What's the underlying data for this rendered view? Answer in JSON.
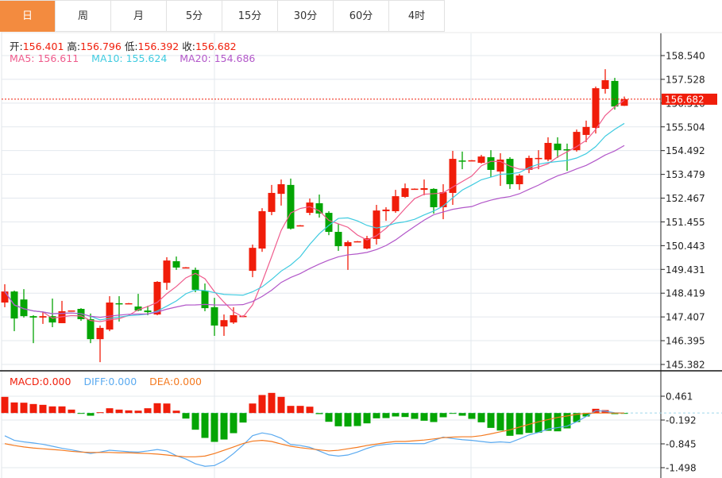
{
  "tabs": [
    {
      "label": "日",
      "active": true
    },
    {
      "label": "周"
    },
    {
      "label": "月"
    },
    {
      "label": "5分"
    },
    {
      "label": "15分"
    },
    {
      "label": "30分"
    },
    {
      "label": "60分"
    },
    {
      "label": "4时"
    }
  ],
  "ohlc_info": {
    "open_label": "开:",
    "open": "156.401",
    "high_label": "高:",
    "high": "156.796",
    "low_label": "低:",
    "low": "156.392",
    "close_label": "收:",
    "close": "156.682"
  },
  "ma_info": {
    "ma5": "MA5: 156.611",
    "ma10": "MA10: 155.624",
    "ma20": "MA20: 154.686"
  },
  "macd_info": {
    "macd": "MACD:0.000",
    "diff": "DIFF:0.000",
    "dea": "DEA:0.000"
  },
  "colors": {
    "up": "#f01d0a",
    "down": "#04a504",
    "ma5": "#ef5b8c",
    "ma10": "#3fcbe0",
    "ma20": "#b257c9",
    "diff": "#5aaaf0",
    "dea": "#f47a20",
    "active_tab": "#f38b3f"
  },
  "chart_data": [
    {
      "type": "candlestick",
      "price_ticks": [
        "158.540",
        "157.528",
        "156.516",
        "155.504",
        "154.492",
        "153.479",
        "152.467",
        "151.455",
        "150.443",
        "149.431",
        "148.419",
        "147.407",
        "146.395",
        "145.382"
      ],
      "ylim": [
        145.382,
        158.54
      ],
      "current_price": "156.682",
      "grid": true,
      "candles_ohlc": [
        [
          148.02,
          148.8,
          147.82,
          148.49
        ],
        [
          148.49,
          148.53,
          146.8,
          147.34
        ],
        [
          148.15,
          148.59,
          147.38,
          147.44
        ],
        [
          147.44,
          147.48,
          146.29,
          147.38
        ],
        [
          147.38,
          147.61,
          147.11,
          147.44
        ],
        [
          147.44,
          148.19,
          146.97,
          147.17
        ],
        [
          147.14,
          148.09,
          147.14,
          147.65
        ],
        [
          147.65,
          147.68,
          147.65,
          147.68
        ],
        [
          147.75,
          147.78,
          147.24,
          147.31
        ],
        [
          147.31,
          147.55,
          146.29,
          146.46
        ],
        [
          146.46,
          147.04,
          145.48,
          146.94
        ],
        [
          146.87,
          148.29,
          146.8,
          148.02
        ],
        [
          147.99,
          148.29,
          147.21,
          147.95
        ],
        [
          147.97,
          148.0,
          147.96,
          147.99
        ],
        [
          147.85,
          148.39,
          147.65,
          147.68
        ],
        [
          147.68,
          147.88,
          147.48,
          147.61
        ],
        [
          147.51,
          148.93,
          147.48,
          148.9
        ],
        [
          148.86,
          149.95,
          148.56,
          149.81
        ],
        [
          149.78,
          149.98,
          149.41,
          149.51
        ],
        [
          149.5,
          149.53,
          149.49,
          149.52
        ],
        [
          149.41,
          149.51,
          148.46,
          148.56
        ],
        [
          148.53,
          148.83,
          147.65,
          147.78
        ],
        [
          147.82,
          148.22,
          146.6,
          147.04
        ],
        [
          147.0,
          147.51,
          146.6,
          147.27
        ],
        [
          147.17,
          147.82,
          147.11,
          147.48
        ],
        [
          147.43,
          147.47,
          147.42,
          147.45
        ],
        [
          149.37,
          150.49,
          149.1,
          150.35
        ],
        [
          150.32,
          152.04,
          150.18,
          151.91
        ],
        [
          151.88,
          153.03,
          151.74,
          152.69
        ],
        [
          152.65,
          153.26,
          152.15,
          153.06
        ],
        [
          153.03,
          153.3,
          151.13,
          151.17
        ],
        [
          151.29,
          151.32,
          151.28,
          151.31
        ],
        [
          151.84,
          152.45,
          151.74,
          152.28
        ],
        [
          152.25,
          152.62,
          151.64,
          151.81
        ],
        [
          151.84,
          151.91,
          150.89,
          151.03
        ],
        [
          151.03,
          151.37,
          150.22,
          150.42
        ],
        [
          150.42,
          150.66,
          149.41,
          150.59
        ],
        [
          150.61,
          150.64,
          150.6,
          150.63
        ],
        [
          150.32,
          150.86,
          150.29,
          150.76
        ],
        [
          150.73,
          152.18,
          150.49,
          151.94
        ],
        [
          151.91,
          152.08,
          151.5,
          151.98
        ],
        [
          151.91,
          152.82,
          151.84,
          152.55
        ],
        [
          152.52,
          153.09,
          152.48,
          152.89
        ],
        [
          152.85,
          152.88,
          152.84,
          152.87
        ],
        [
          152.82,
          153.26,
          152.59,
          152.89
        ],
        [
          152.86,
          152.89,
          151.81,
          152.08
        ],
        [
          152.08,
          153.06,
          151.57,
          152.72
        ],
        [
          152.69,
          154.48,
          152.18,
          154.14
        ],
        [
          154.07,
          154.45,
          153.7,
          154.04
        ],
        [
          154.06,
          154.09,
          154.05,
          154.08
        ],
        [
          153.97,
          154.31,
          153.94,
          154.24
        ],
        [
          154.21,
          154.51,
          153.36,
          153.67
        ],
        [
          153.6,
          154.38,
          152.99,
          154.11
        ],
        [
          154.14,
          154.21,
          152.86,
          153.06
        ],
        [
          153.06,
          153.5,
          152.82,
          153.43
        ],
        [
          153.67,
          154.28,
          153.53,
          154.18
        ],
        [
          154.14,
          154.51,
          153.7,
          154.18
        ],
        [
          154.11,
          155.06,
          154.04,
          154.82
        ],
        [
          154.79,
          155.06,
          154.18,
          154.51
        ],
        [
          154.55,
          154.79,
          153.63,
          154.51
        ],
        [
          154.51,
          155.39,
          154.45,
          155.29
        ],
        [
          155.16,
          155.77,
          154.85,
          155.5
        ],
        [
          155.46,
          157.22,
          155.22,
          157.15
        ],
        [
          157.12,
          157.96,
          156.92,
          157.49
        ],
        [
          157.46,
          157.59,
          156.24,
          156.37
        ],
        [
          156.401,
          156.796,
          156.392,
          156.682
        ]
      ],
      "moving_averages": [
        5,
        10,
        20
      ]
    },
    {
      "type": "bar+line",
      "ticks": [
        "0.461",
        "-0.192",
        "-0.845",
        "-1.498"
      ],
      "ylim": [
        -1.498,
        0.461
      ],
      "histogram": [
        0.443,
        0.29,
        0.283,
        0.247,
        0.225,
        0.182,
        0.182,
        0.094,
        -0.01,
        -0.073,
        0.022,
        0.131,
        0.094,
        0.073,
        0.065,
        0.131,
        0.269,
        0.261,
        0.065,
        -0.152,
        -0.457,
        -0.682,
        -0.791,
        -0.726,
        -0.552,
        -0.261,
        0.261,
        0.494,
        0.552,
        0.443,
        0.196,
        0.196,
        0.174,
        -0.029,
        -0.24,
        -0.363,
        -0.37,
        -0.356,
        -0.283,
        -0.145,
        -0.138,
        -0.094,
        -0.109,
        -0.16,
        -0.211,
        -0.247,
        -0.116,
        -0.005,
        -0.073,
        -0.16,
        -0.254,
        -0.407,
        -0.479,
        -0.624,
        -0.588,
        -0.545,
        -0.537,
        -0.486,
        -0.501,
        -0.421,
        -0.247,
        -0.094,
        0.116,
        0.08,
        -0.029,
        -0.01
      ],
      "diff": [
        -0.624,
        -0.748,
        -0.79,
        -0.82,
        -0.857,
        -0.91,
        -0.966,
        -1.01,
        -1.06,
        -1.11,
        -1.07,
        -1.02,
        -1.04,
        -1.06,
        -1.07,
        -1.04,
        -1.0,
        -1.04,
        -1.17,
        -1.26,
        -1.39,
        -1.46,
        -1.44,
        -1.31,
        -1.11,
        -0.88,
        -0.62,
        -0.545,
        -0.59,
        -0.69,
        -0.864,
        -0.89,
        -0.94,
        -1.04,
        -1.147,
        -1.18,
        -1.15,
        -1.07,
        -0.97,
        -0.89,
        -0.86,
        -0.835,
        -0.835,
        -0.84,
        -0.84,
        -0.75,
        -0.66,
        -0.7,
        -0.73,
        -0.75,
        -0.78,
        -0.81,
        -0.79,
        -0.81,
        -0.71,
        -0.6,
        -0.53,
        -0.44,
        -0.4,
        -0.36,
        -0.24,
        -0.094,
        0.065,
        0.05,
        0.007,
        0.0
      ],
      "dea": [
        -0.84,
        -0.89,
        -0.93,
        -0.96,
        -0.98,
        -1.0,
        -1.02,
        -1.05,
        -1.07,
        -1.08,
        -1.08,
        -1.08,
        -1.09,
        -1.09,
        -1.1,
        -1.11,
        -1.125,
        -1.15,
        -1.18,
        -1.2,
        -1.2,
        -1.18,
        -1.11,
        -1.02,
        -0.93,
        -0.835,
        -0.77,
        -0.75,
        -0.78,
        -0.85,
        -0.91,
        -0.95,
        -0.98,
        -1.01,
        -1.04,
        -1.02,
        -0.98,
        -0.94,
        -0.89,
        -0.85,
        -0.81,
        -0.78,
        -0.78,
        -0.76,
        -0.74,
        -0.71,
        -0.675,
        -0.66,
        -0.65,
        -0.65,
        -0.62,
        -0.57,
        -0.515,
        -0.46,
        -0.385,
        -0.31,
        -0.24,
        -0.18,
        -0.12,
        -0.08,
        -0.036,
        -0.007,
        0.0,
        0.0,
        0.0,
        0.0
      ]
    }
  ]
}
